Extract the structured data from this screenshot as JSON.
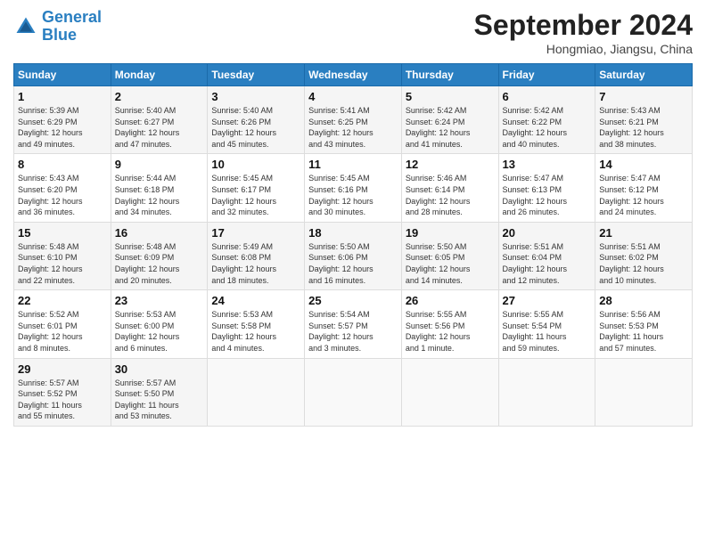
{
  "header": {
    "logo_line1": "General",
    "logo_line2": "Blue",
    "month": "September 2024",
    "location": "Hongmiao, Jiangsu, China"
  },
  "weekdays": [
    "Sunday",
    "Monday",
    "Tuesday",
    "Wednesday",
    "Thursday",
    "Friday",
    "Saturday"
  ],
  "weeks": [
    [
      {
        "day": "1",
        "info": "Sunrise: 5:39 AM\nSunset: 6:29 PM\nDaylight: 12 hours\nand 49 minutes."
      },
      {
        "day": "2",
        "info": "Sunrise: 5:40 AM\nSunset: 6:27 PM\nDaylight: 12 hours\nand 47 minutes."
      },
      {
        "day": "3",
        "info": "Sunrise: 5:40 AM\nSunset: 6:26 PM\nDaylight: 12 hours\nand 45 minutes."
      },
      {
        "day": "4",
        "info": "Sunrise: 5:41 AM\nSunset: 6:25 PM\nDaylight: 12 hours\nand 43 minutes."
      },
      {
        "day": "5",
        "info": "Sunrise: 5:42 AM\nSunset: 6:24 PM\nDaylight: 12 hours\nand 41 minutes."
      },
      {
        "day": "6",
        "info": "Sunrise: 5:42 AM\nSunset: 6:22 PM\nDaylight: 12 hours\nand 40 minutes."
      },
      {
        "day": "7",
        "info": "Sunrise: 5:43 AM\nSunset: 6:21 PM\nDaylight: 12 hours\nand 38 minutes."
      }
    ],
    [
      {
        "day": "8",
        "info": "Sunrise: 5:43 AM\nSunset: 6:20 PM\nDaylight: 12 hours\nand 36 minutes."
      },
      {
        "day": "9",
        "info": "Sunrise: 5:44 AM\nSunset: 6:18 PM\nDaylight: 12 hours\nand 34 minutes."
      },
      {
        "day": "10",
        "info": "Sunrise: 5:45 AM\nSunset: 6:17 PM\nDaylight: 12 hours\nand 32 minutes."
      },
      {
        "day": "11",
        "info": "Sunrise: 5:45 AM\nSunset: 6:16 PM\nDaylight: 12 hours\nand 30 minutes."
      },
      {
        "day": "12",
        "info": "Sunrise: 5:46 AM\nSunset: 6:14 PM\nDaylight: 12 hours\nand 28 minutes."
      },
      {
        "day": "13",
        "info": "Sunrise: 5:47 AM\nSunset: 6:13 PM\nDaylight: 12 hours\nand 26 minutes."
      },
      {
        "day": "14",
        "info": "Sunrise: 5:47 AM\nSunset: 6:12 PM\nDaylight: 12 hours\nand 24 minutes."
      }
    ],
    [
      {
        "day": "15",
        "info": "Sunrise: 5:48 AM\nSunset: 6:10 PM\nDaylight: 12 hours\nand 22 minutes."
      },
      {
        "day": "16",
        "info": "Sunrise: 5:48 AM\nSunset: 6:09 PM\nDaylight: 12 hours\nand 20 minutes."
      },
      {
        "day": "17",
        "info": "Sunrise: 5:49 AM\nSunset: 6:08 PM\nDaylight: 12 hours\nand 18 minutes."
      },
      {
        "day": "18",
        "info": "Sunrise: 5:50 AM\nSunset: 6:06 PM\nDaylight: 12 hours\nand 16 minutes."
      },
      {
        "day": "19",
        "info": "Sunrise: 5:50 AM\nSunset: 6:05 PM\nDaylight: 12 hours\nand 14 minutes."
      },
      {
        "day": "20",
        "info": "Sunrise: 5:51 AM\nSunset: 6:04 PM\nDaylight: 12 hours\nand 12 minutes."
      },
      {
        "day": "21",
        "info": "Sunrise: 5:51 AM\nSunset: 6:02 PM\nDaylight: 12 hours\nand 10 minutes."
      }
    ],
    [
      {
        "day": "22",
        "info": "Sunrise: 5:52 AM\nSunset: 6:01 PM\nDaylight: 12 hours\nand 8 minutes."
      },
      {
        "day": "23",
        "info": "Sunrise: 5:53 AM\nSunset: 6:00 PM\nDaylight: 12 hours\nand 6 minutes."
      },
      {
        "day": "24",
        "info": "Sunrise: 5:53 AM\nSunset: 5:58 PM\nDaylight: 12 hours\nand 4 minutes."
      },
      {
        "day": "25",
        "info": "Sunrise: 5:54 AM\nSunset: 5:57 PM\nDaylight: 12 hours\nand 3 minutes."
      },
      {
        "day": "26",
        "info": "Sunrise: 5:55 AM\nSunset: 5:56 PM\nDaylight: 12 hours\nand 1 minute."
      },
      {
        "day": "27",
        "info": "Sunrise: 5:55 AM\nSunset: 5:54 PM\nDaylight: 11 hours\nand 59 minutes."
      },
      {
        "day": "28",
        "info": "Sunrise: 5:56 AM\nSunset: 5:53 PM\nDaylight: 11 hours\nand 57 minutes."
      }
    ],
    [
      {
        "day": "29",
        "info": "Sunrise: 5:57 AM\nSunset: 5:52 PM\nDaylight: 11 hours\nand 55 minutes."
      },
      {
        "day": "30",
        "info": "Sunrise: 5:57 AM\nSunset: 5:50 PM\nDaylight: 11 hours\nand 53 minutes."
      },
      {
        "day": "",
        "info": ""
      },
      {
        "day": "",
        "info": ""
      },
      {
        "day": "",
        "info": ""
      },
      {
        "day": "",
        "info": ""
      },
      {
        "day": "",
        "info": ""
      }
    ]
  ]
}
